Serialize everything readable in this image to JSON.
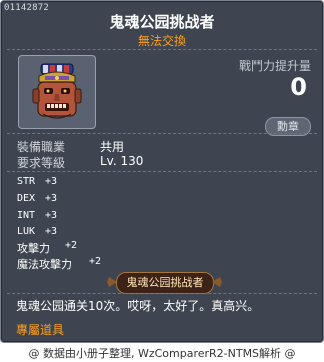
{
  "item": {
    "id": "01142872",
    "name": "鬼魂公园挑战者",
    "trade_status": "無法交換"
  },
  "combat_power": {
    "label": "戰鬥力提升量",
    "value": "0"
  },
  "medal_button": {
    "label": "勳章"
  },
  "requirements": [
    {
      "label": "裝備職業",
      "value": "共用"
    },
    {
      "label": "要求等級",
      "value": "Lv. 130"
    }
  ],
  "stats": [
    {
      "name": "STR",
      "value": "+3"
    },
    {
      "name": "DEX",
      "value": "+3"
    },
    {
      "name": "INT",
      "value": "+3"
    },
    {
      "name": "LUK",
      "value": "+3"
    },
    {
      "name": "攻擊力",
      "value": "+2"
    },
    {
      "name": "魔法攻擊力",
      "value": "+2"
    }
  ],
  "badge": {
    "label": "鬼魂公园挑战者"
  },
  "description": "鬼魂公园通关10次。哎呀，太好了。真高兴。",
  "exclusive_label": "專屬道具",
  "footer": "@ 数据由小册子整理, WzComparerR2-NTMS解析 @",
  "colors": {
    "panel_bg": "#3f4550",
    "trade_status": "#ff9f1c",
    "exclusive_label": "#ff9f1c",
    "badge_bg": "#3d2317"
  },
  "icons": {
    "item_icon": "ghost-mask-medal-icon"
  }
}
